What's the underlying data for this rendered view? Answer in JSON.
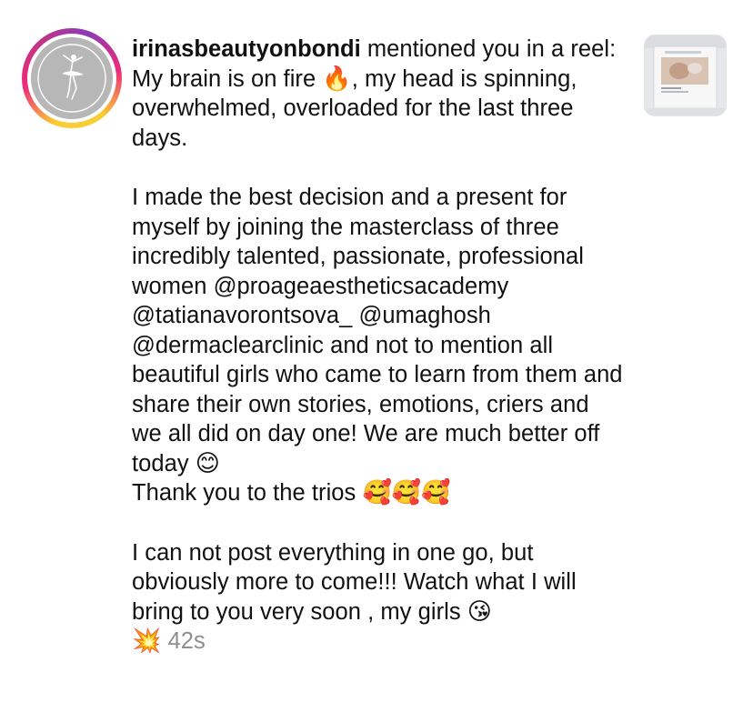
{
  "notification": {
    "username": "irinasbeautyonbondi",
    "intro_text": " mentioned you in a reel: My brain is on fire ",
    "emoji_fire": "🔥",
    "intro_text_2": ", my head is spinning, overwhelmed, overloaded for the last three days.",
    "para2_text": "I made the best decision and a present for myself by joining the masterclass of three incredibly talented, passionate, professional women @proageaestheticsacademy @tatianavorontsova_ @umaghosh @dermaclearclinic and not to mention all beautiful girls who came to learn from them and share their own stories, emotions, criers and we all did on day one! We are much better off today ",
    "emoji_smile": "😊",
    "para2_text_2": "Thank you to the trios ",
    "emoji_hearts": "🥰🥰🥰",
    "para3_text": "I can not  post everything in one go, but obviously more to come!!! Watch what I will bring to you very soon , my girls ",
    "emoji_kiss": "😘",
    "emoji_boom": "💥",
    "timestamp": "42s"
  },
  "avatar": {
    "icon": "ballerina-logo-icon"
  },
  "thumbnail": {
    "icon": "reel-thumbnail"
  }
}
